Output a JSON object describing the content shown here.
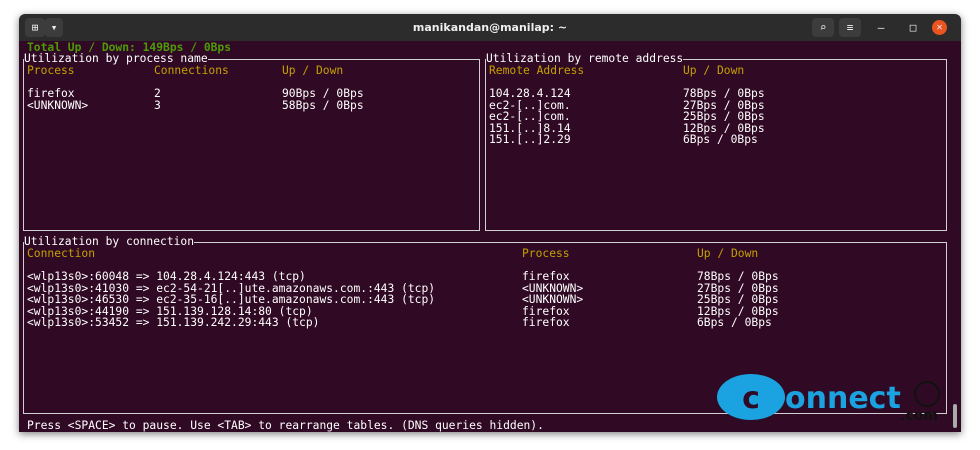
{
  "window": {
    "title": "manikandan@manilap: ~"
  },
  "total": "Total Up / Down: 149Bps / 0Bps",
  "process_table": {
    "title": "Utilization by process name",
    "headers": [
      "Process",
      "Connections",
      "Up / Down"
    ],
    "rows": [
      [
        "firefox",
        "2",
        "90Bps / 0Bps"
      ],
      [
        "<UNKNOWN>",
        "3",
        "58Bps / 0Bps"
      ]
    ]
  },
  "remote_table": {
    "title": "Utilization by remote address",
    "headers": [
      "Remote Address",
      "Up / Down"
    ],
    "rows": [
      [
        "104.28.4.124",
        "78Bps / 0Bps"
      ],
      [
        "ec2-[..]com.",
        "27Bps / 0Bps"
      ],
      [
        "ec2-[..]com.",
        "25Bps / 0Bps"
      ],
      [
        "151.[..]8.14",
        "12Bps / 0Bps"
      ],
      [
        "151.[..]2.29",
        "6Bps / 0Bps"
      ]
    ]
  },
  "connection_table": {
    "title": "Utilization by connection",
    "headers": [
      "Connection",
      "Process",
      "Up / Down"
    ],
    "rows": [
      [
        "<wlp13s0>:60048 => 104.28.4.124:443 (tcp)",
        "firefox",
        "78Bps / 0Bps"
      ],
      [
        "<wlp13s0>:41030 => ec2-54-21[..]ute.amazonaws.com.:443 (tcp)",
        "<UNKNOWN>",
        "27Bps / 0Bps"
      ],
      [
        "<wlp13s0>:46530 => ec2-35-16[..]ute.amazonaws.com.:443 (tcp)",
        "<UNKNOWN>",
        "25Bps / 0Bps"
      ],
      [
        "<wlp13s0>:44190 => 151.139.128.14:80 (tcp)",
        "firefox",
        "12Bps / 0Bps"
      ],
      [
        "<wlp13s0>:53452 => 151.139.242.29:443 (tcp)",
        "firefox",
        "6Bps / 0Bps"
      ]
    ]
  },
  "status": "Press <SPACE> to pause. Use <TAB> to rearrange tables. (DNS queries hidden).",
  "watermark": "Connect.com",
  "icons": {
    "new_tab": "new-tab-icon",
    "menu": "chevron-down-icon",
    "search": "search-icon",
    "hamburger": "hamburger-icon",
    "minimize": "minimize-icon",
    "maximize": "maximize-icon",
    "close": "close-icon"
  }
}
